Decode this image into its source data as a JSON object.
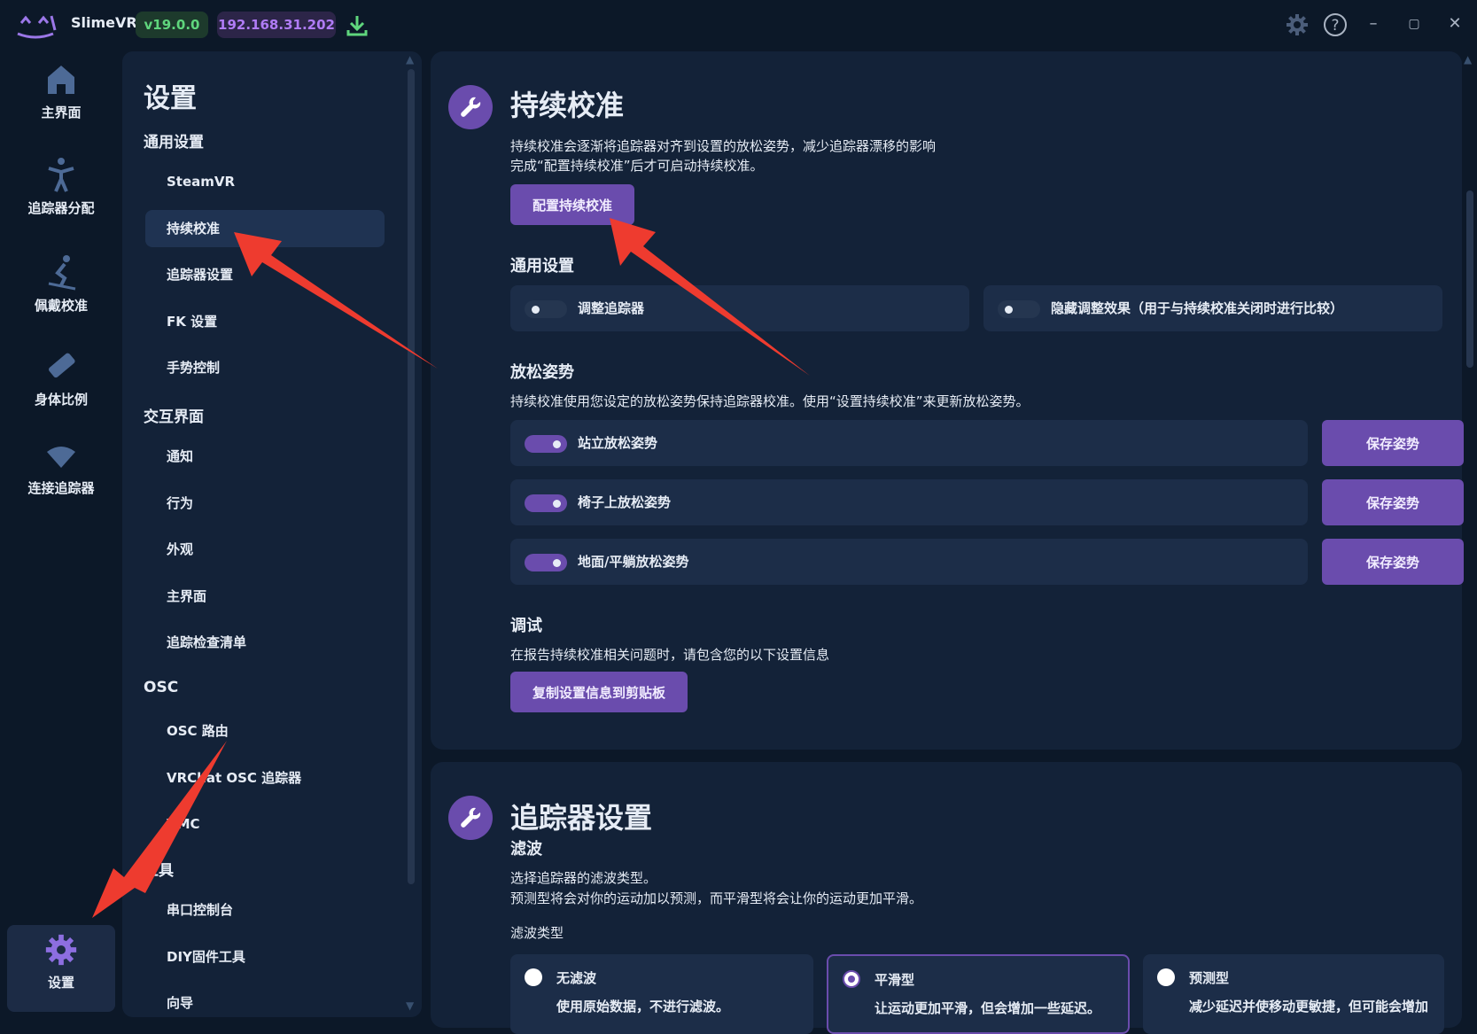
{
  "titlebar": {
    "app_name": "SlimeVR",
    "version": "v19.0.0",
    "ip": "192.168.31.202"
  },
  "nav": [
    {
      "label": "主界面"
    },
    {
      "label": "追踪器分配"
    },
    {
      "label": "佩戴校准"
    },
    {
      "label": "身体比例"
    },
    {
      "label": "连接追踪器"
    },
    {
      "label": "设置"
    }
  ],
  "menu": {
    "title": "设置",
    "sections": [
      {
        "title": "通用设置",
        "items": [
          "SteamVR",
          "持续校准",
          "追踪器设置",
          "FK 设置",
          "手势控制"
        ]
      },
      {
        "title": "交互界面",
        "items": [
          "通知",
          "行为",
          "外观",
          "主界面",
          "追踪检查清单"
        ]
      },
      {
        "title": "OSC",
        "items": [
          "OSC 路由",
          "VRChat OSC 追踪器",
          "VMC"
        ]
      },
      {
        "title": "工具",
        "items": [
          "串口控制台",
          "DIY固件工具",
          "向导"
        ]
      }
    ],
    "active_item": "持续校准"
  },
  "calibration": {
    "title": "持续校准",
    "desc_line1": "持续校准会逐渐将追踪器对齐到设置的放松姿势，减少追踪器漂移的影响",
    "desc_line2": "完成“配置持续校准”后才可启动持续校准。",
    "config_button": "配置持续校准",
    "general_heading": "通用设置",
    "toggle_adjust": "调整追踪器",
    "toggle_hide": "隐藏调整效果（用于与持续校准关闭时进行比较）",
    "relax_heading": "放松姿势",
    "relax_desc": "持续校准使用您设定的放松姿势保持追踪器校准。使用“设置持续校准”来更新放松姿势。",
    "poses": [
      {
        "label": "站立放松姿势",
        "button": "保存姿势"
      },
      {
        "label": "椅子上放松姿势",
        "button": "保存姿势"
      },
      {
        "label": "地面/平躺放松姿势",
        "button": "保存姿势"
      }
    ],
    "debug_heading": "调试",
    "debug_desc": "在报告持续校准相关问题时，请包含您的以下设置信息",
    "copy_button": "复制设置信息到剪贴板"
  },
  "tracker_settings": {
    "title": "追踪器设置",
    "filter_heading": "滤波",
    "filter_desc1": "选择追踪器的滤波类型。",
    "filter_desc2": "预测型将会对你的运动加以预测，而平滑型将会让你的运动更加平滑。",
    "filter_type_label": "滤波类型",
    "options": [
      {
        "title": "无滤波",
        "desc": "使用原始数据，不进行滤波。"
      },
      {
        "title": "平滑型",
        "desc": "让运动更加平滑，但会增加一些延迟。"
      },
      {
        "title": "预测型",
        "desc": "减少延迟并使移动更敏捷，但可能会增加"
      }
    ],
    "selected_option": "平滑型"
  },
  "colors": {
    "accent": "#6a4cad",
    "background": "#0c1828",
    "panel": "#132238",
    "annotation_arrow": "#ee3b2f"
  }
}
